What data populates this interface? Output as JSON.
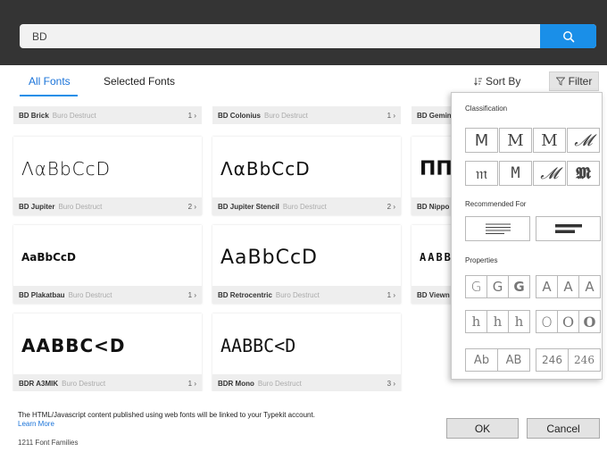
{
  "search": {
    "value": "BD",
    "button_icon": "search-icon"
  },
  "tabs": [
    {
      "label": "All Fonts",
      "active": true
    },
    {
      "label": "Selected Fonts",
      "active": false
    }
  ],
  "toolbar": {
    "sort_label": "Sort By",
    "sort_icon": "sort-icon",
    "filter_label": "Filter",
    "filter_icon": "funnel-icon"
  },
  "partial_row": [
    {
      "name": "BD Brick",
      "foundry": "Buro Destruct",
      "count": "1"
    },
    {
      "name": "BD Colonius",
      "foundry": "Buro Destruct",
      "count": "1"
    },
    {
      "name": "BD Gemin",
      "foundry": "",
      "count": ""
    }
  ],
  "fonts": [
    {
      "preview": "ΛαBbCcD",
      "name": "BD Jupiter",
      "foundry": "Buro Destruct",
      "count": "2"
    },
    {
      "preview": "ΛαBbCcD",
      "name": "BD Jupiter Stencil",
      "foundry": "Buro Destruct",
      "count": "2"
    },
    {
      "preview": "ΠΠ",
      "name": "BD Nippo",
      "foundry": "",
      "count": ""
    },
    {
      "preview": "AaBbCcD",
      "name": "BD Plakatbau",
      "foundry": "Buro Destruct",
      "count": "1"
    },
    {
      "preview": "AaBbCcD",
      "name": "BD Retrocentric",
      "foundry": "Buro Destruct",
      "count": "1"
    },
    {
      "preview": "AABB",
      "name": "BD Viewn",
      "foundry": "",
      "count": ""
    },
    {
      "preview": "AABBC<D",
      "name": "BDR A3MIK",
      "foundry": "Buro Destruct",
      "count": "1"
    },
    {
      "preview": "AABBC<D",
      "name": "BDR Mono",
      "foundry": "Buro Destruct",
      "count": "3"
    }
  ],
  "filter_panel": {
    "classification_label": "Classification",
    "classification_glyphs": [
      "M",
      "M",
      "M",
      "𝓜",
      "𝔪",
      "M",
      "𝓜",
      "𝕸"
    ],
    "recommended_label": "Recommended For",
    "recommended_icons": [
      "paragraph-icon",
      "heading-icon"
    ],
    "properties_label": "Properties",
    "weight": [
      "G",
      "G",
      "G"
    ],
    "width": [
      "A",
      "A",
      "A"
    ],
    "xheight": [
      "h",
      "h",
      "h"
    ],
    "contrast": [
      "O",
      "O",
      "O"
    ],
    "case": [
      "Ab",
      "AB"
    ],
    "figures": [
      "246",
      "246"
    ]
  },
  "footer": {
    "notice": "The HTML/Javascript content published using web fonts will be linked to your Typekit account.",
    "learn_more": "Learn More",
    "families": "1211 Font Families",
    "ok_label": "OK",
    "cancel_label": "Cancel"
  },
  "colors": {
    "accent": "#1a8fe8",
    "header": "#343434"
  }
}
